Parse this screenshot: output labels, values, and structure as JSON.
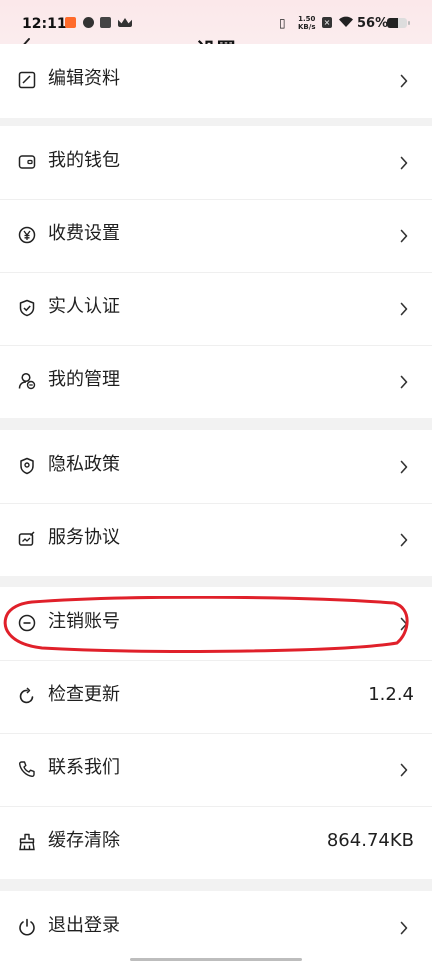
{
  "status_bar": {
    "time": "12:11",
    "net_speed_top": "1.50",
    "net_speed_unit": "KB/s",
    "battery": "56%",
    "battery_level": 0.56
  },
  "header": {
    "title": "设置"
  },
  "groups": [
    {
      "items": [
        {
          "label": "编辑资料",
          "icon": "edit-profile-icon"
        }
      ]
    },
    {
      "items": [
        {
          "label": "我的钱包",
          "icon": "wallet-icon"
        },
        {
          "label": "收费设置",
          "icon": "yen-icon"
        },
        {
          "label": "实人认证",
          "icon": "shield-check-icon"
        },
        {
          "label": "我的管理",
          "icon": "user-manage-icon"
        }
      ]
    },
    {
      "items": [
        {
          "label": "隐私政策",
          "icon": "location-shield-icon"
        },
        {
          "label": "服务协议",
          "icon": "agreement-icon"
        }
      ]
    },
    {
      "items": [
        {
          "label": "注销账号",
          "icon": "minus-circle-icon"
        },
        {
          "label": "检查更新",
          "icon": "refresh-icon",
          "value": "1.2.4"
        },
        {
          "label": "联系我们",
          "icon": "phone-icon"
        },
        {
          "label": "缓存清除",
          "icon": "clear-cache-icon",
          "value": "864.74KB"
        }
      ]
    },
    {
      "items": [
        {
          "label": "退出登录",
          "icon": "power-icon"
        }
      ]
    }
  ],
  "colors": {
    "annotation": "#e0202a",
    "header_bg": "#fbe9eb"
  }
}
